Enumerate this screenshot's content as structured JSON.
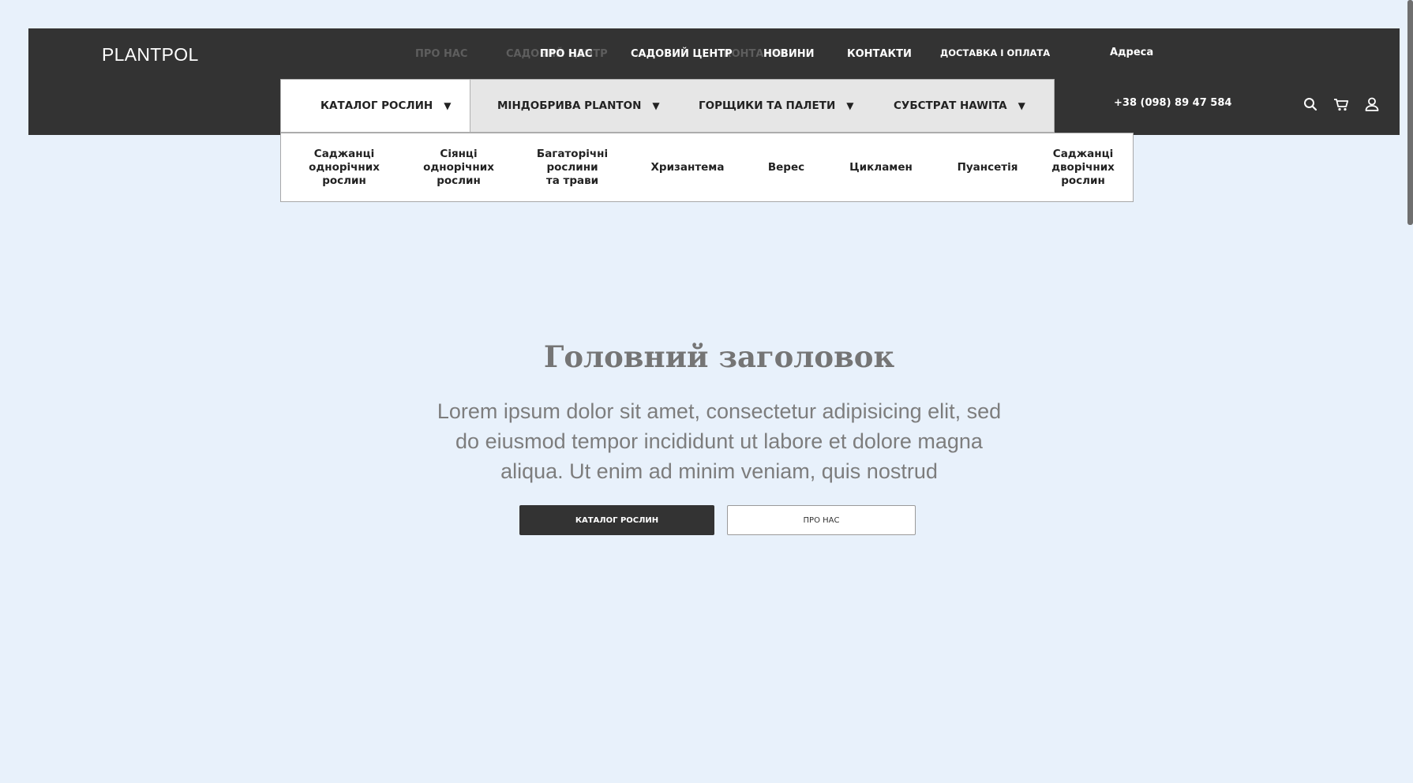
{
  "header": {
    "logo": "PLANTPOL",
    "ghost_nav": [
      "ПРО НАС",
      "САДОВИЙ ЦЕНТР",
      "КОНТАКТИ"
    ],
    "nav": [
      "ПРО НАС",
      "САДОВИЙ ЦЕНТР",
      "НОВИНИ",
      "КОНТАКТИ"
    ],
    "delivery": "ДОСТАВКА І ОПЛАТА",
    "address": "Адреса",
    "phone": "+38 (098) 89 47 584",
    "icons": [
      "search-icon",
      "cart-icon",
      "user-icon"
    ]
  },
  "catalog_tabs": [
    {
      "label": "КАТАЛОГ РОСЛИН",
      "arrow": "▼",
      "active": true
    },
    {
      "label": "МІНДОБРИВА PLANTON",
      "arrow": "▼"
    },
    {
      "label": "ГОРЩИКИ ТА ПАЛЕТИ",
      "arrow": "▼"
    },
    {
      "label": "СУБСТРАТ HAWITA",
      "arrow": "▼"
    }
  ],
  "submenu": [
    "Саджанці\nоднорічних\nрослин",
    "Сіянці\nоднорічних\nрослин",
    "Багаторічні\nрослини\nта трави",
    "Хризантема",
    "Верес",
    "Цикламен",
    "Пуансетія",
    "Саджанці\nдворічних\nрослин"
  ],
  "hero": {
    "title": "Головний заголовок",
    "text": "Lorem ipsum dolor sit amet, consectetur adipisicing elit, sed do eiusmod tempor incididunt ut labore et dolore magna aliqua. Ut enim ad minim veniam, quis nostrud",
    "primary_button": "КАТАЛОГ РОСЛИН",
    "secondary_button": "ПРО НАС"
  },
  "colors": {
    "background": "#e8f1fb",
    "header": "#333333",
    "catbar": "#e6e6e6",
    "text_muted": "#7d7d7d"
  }
}
